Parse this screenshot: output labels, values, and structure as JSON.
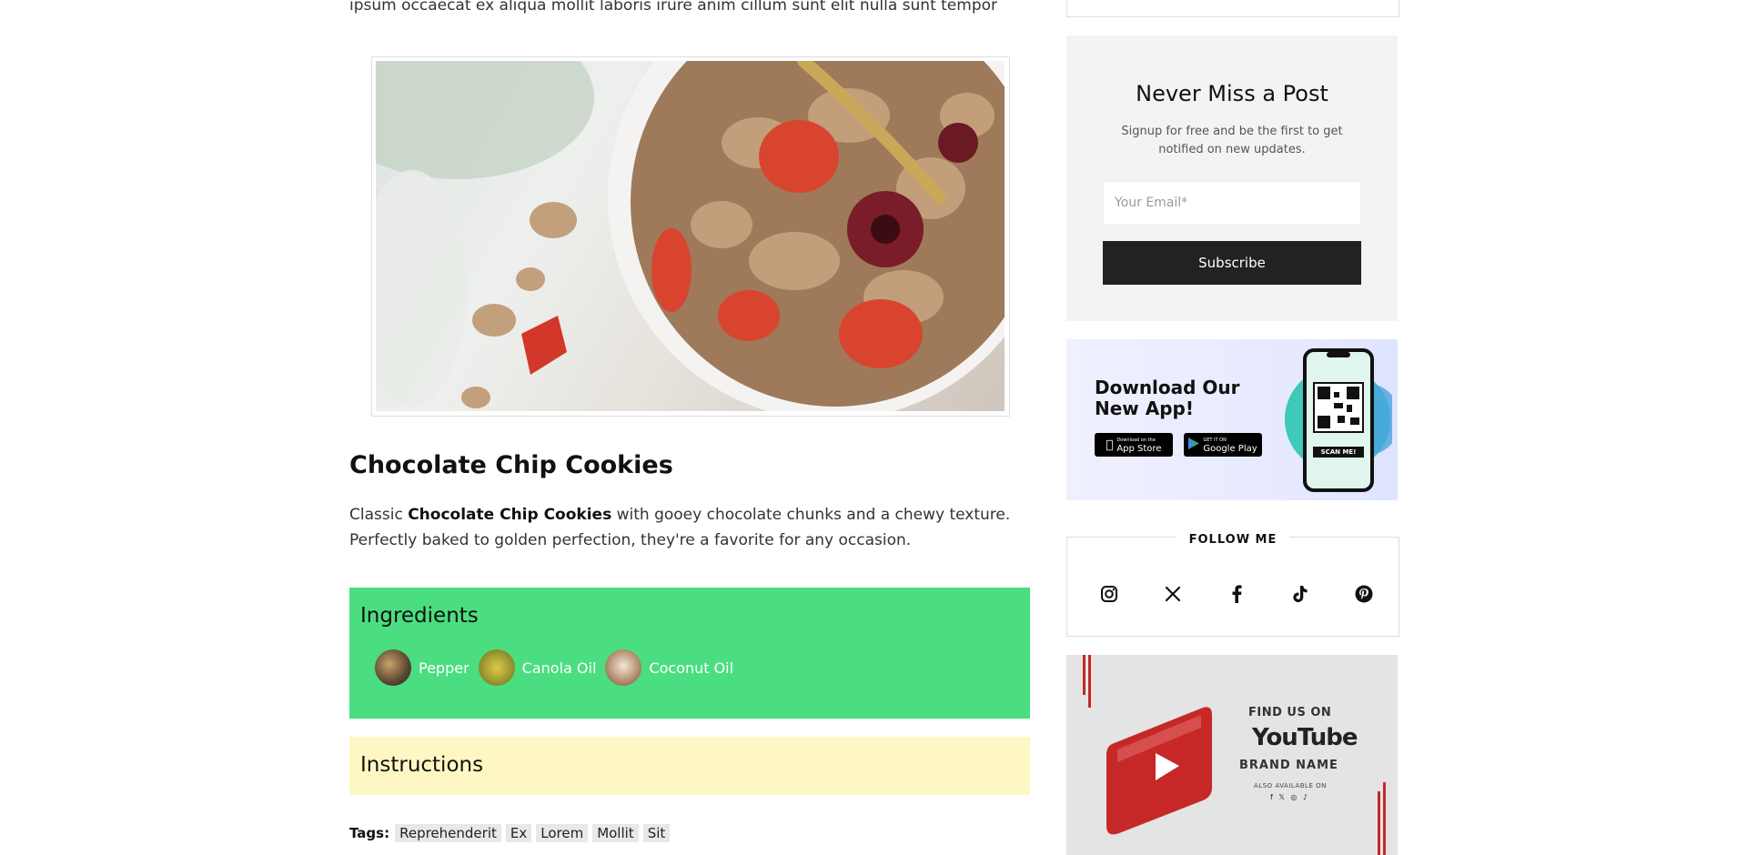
{
  "article": {
    "intro_text": "ipsum occaecat ex aliqua mollit laboris irure anim cillum sunt elit nulla sunt tempor",
    "recipe": {
      "title": "Chocolate Chip Cookies",
      "desc_prefix": "Classic ",
      "desc_bold": "Chocolate Chip Cookies",
      "desc_suffix": " with gooey chocolate chunks and a chewy texture. Perfectly baked to golden perfection, they're a favorite for any occasion."
    },
    "ingredients": {
      "title": "Ingredients",
      "items": [
        {
          "label": "Pepper",
          "color": "#5a4630"
        },
        {
          "label": "Canola Oil",
          "color": "#b8a23a"
        },
        {
          "label": "Coconut Oil",
          "color": "#b08a6a"
        }
      ]
    },
    "instructions": {
      "title": "Instructions"
    },
    "tags": {
      "label": "Tags:",
      "items": [
        "Reprehenderit",
        "Ex",
        "Lorem",
        "Mollit",
        "Sit"
      ]
    }
  },
  "sidebar": {
    "newsletter": {
      "title": "Never Miss a Post",
      "text": "Signup for free and be the first to get notified on new updates.",
      "placeholder": "Your Email*",
      "button": "Subscribe"
    },
    "app_banner": {
      "title_line1": "Download Our",
      "title_line2": "New App!",
      "app_store": "App Store",
      "app_store_caption": "Download on the",
      "google_play": "Google Play",
      "google_play_caption": "GET IT ON",
      "scan": "SCAN ME!"
    },
    "follow": {
      "title": "FOLLOW ME",
      "icons": [
        "instagram-icon",
        "x-icon",
        "facebook-icon",
        "tiktok-icon",
        "pinterest-icon"
      ]
    },
    "youtube_banner": {
      "find": "FIND US ON",
      "word": "YouTube",
      "brand": "BRAND  NAME",
      "also": "ALSO AVAILABLE ON"
    }
  },
  "colors": {
    "ingredients_bg": "#4ade80",
    "instructions_bg": "#fef7c3",
    "newsletter_bg": "#f3f3f3",
    "button_bg": "#222222",
    "youtube_red": "#d32f2f"
  }
}
